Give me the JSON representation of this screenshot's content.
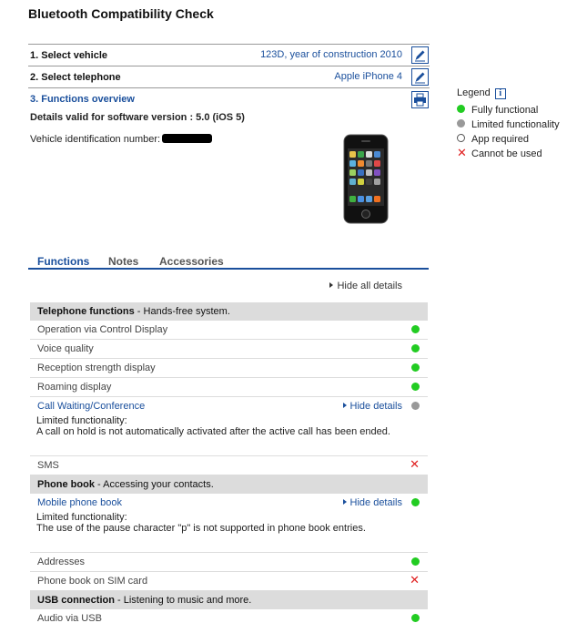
{
  "page_title": "Bluetooth Compatibility Check",
  "steps": {
    "vehicle": {
      "label": "1. Select vehicle",
      "value": "123D, year of construction 2010"
    },
    "telephone": {
      "label": "2. Select telephone",
      "value": "Apple iPhone 4"
    },
    "overview": {
      "label": "3. Functions overview"
    }
  },
  "software_version": "Details valid for software version : 5.0 (iOS 5)",
  "vin_label": "Vehicle identification number:",
  "legend": {
    "title": "Legend",
    "items": [
      {
        "symbol": "green-dot",
        "label": "Fully functional"
      },
      {
        "symbol": "gray-dot",
        "label": "Limited functionality"
      },
      {
        "symbol": "open-circle",
        "label": "App required"
      },
      {
        "symbol": "red-cross",
        "label": "Cannot be used"
      }
    ]
  },
  "tabs": [
    "Functions",
    "Notes",
    "Accessories"
  ],
  "active_tab": "Functions",
  "hide_all_details": "Hide all details",
  "hide_details": "Hide details",
  "sections": [
    {
      "title": "Telephone functions",
      "subtitle": " - Hands-free system.",
      "rows": [
        {
          "label": "Operation via Control Display",
          "status": "green"
        },
        {
          "label": "Voice quality",
          "status": "green"
        },
        {
          "label": "Reception strength display",
          "status": "green"
        },
        {
          "label": "Roaming display",
          "status": "green"
        },
        {
          "label": "Call Waiting/Conference",
          "status": "gray",
          "note_title": "Limited functionality:",
          "note": "A call on hold is not automatically activated after the active call has been ended."
        },
        {
          "label": "SMS",
          "status": "cross"
        }
      ]
    },
    {
      "title": "Phone book",
      "subtitle": " - Accessing your contacts.",
      "rows": [
        {
          "label": "Mobile phone book",
          "status": "green",
          "note_title": "Limited functionality:",
          "note": "The use of the pause character \"p\" is not supported in phone book entries."
        },
        {
          "label": "Addresses",
          "status": "green"
        },
        {
          "label": "Phone book on SIM card",
          "status": "cross"
        }
      ]
    },
    {
      "title": "USB connection",
      "subtitle": " - Listening to music and more.",
      "rows": [
        {
          "label": "Audio via USB",
          "status": "green"
        }
      ]
    }
  ],
  "colors": {
    "accent": "#1a4f9c",
    "green": "#22cc22",
    "gray": "#999999",
    "red": "#e02020",
    "section_bg": "#dcdcdc"
  }
}
